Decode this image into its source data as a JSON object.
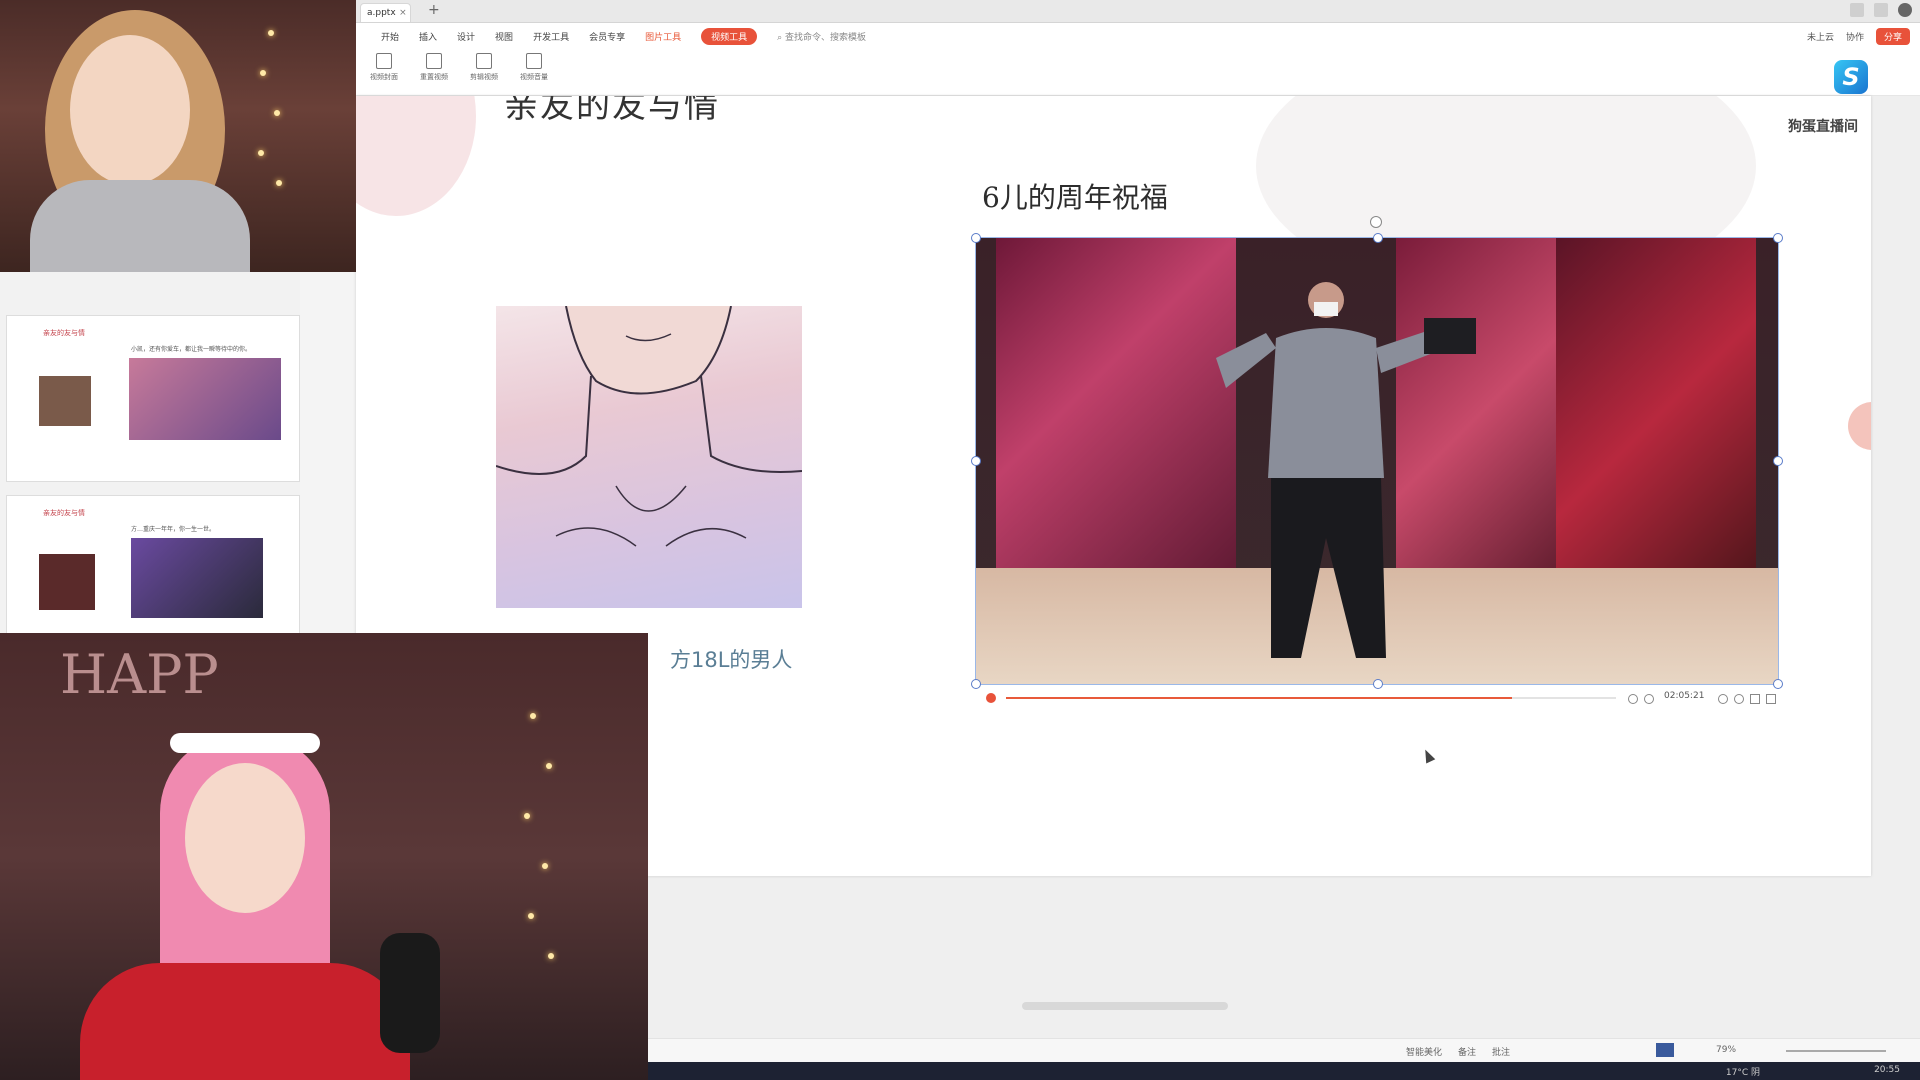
{
  "tabbar": {
    "doc_tab": "a.pptx",
    "new_tab": "+"
  },
  "ribbon": {
    "menu": [
      "开始",
      "插入",
      "设计",
      "视图",
      "开发工具",
      "会员专享",
      "图片工具",
      "视频工具"
    ],
    "search": "查找命令、搜索模板",
    "tools": [
      "视频封面",
      "重置视频",
      "剪辑视频",
      "视频音量"
    ],
    "right": [
      "未上云",
      "协作",
      "分享"
    ]
  },
  "slide": {
    "heading": "亲友的友与情",
    "video_title": "6儿的周年祝福",
    "caption": "方18L的男人",
    "video_time": "02:05:21",
    "video_progress": 0.83
  },
  "thumbnails": [
    {
      "title": "亲友的友与情",
      "caption": "小凯，还有你爱车，都让我一瞬等待中的你。"
    },
    {
      "title": "亲友的友与情",
      "caption": "方…重庆一年年，你一生一世。"
    }
  ],
  "overlay": {
    "logo_letter": "S",
    "watermark": "狗蛋直播间"
  },
  "status": {
    "items": [
      "智能美化",
      "备注",
      "批注"
    ],
    "zoom": "79%"
  },
  "taskbar": {
    "weather": "17°C 阴",
    "clock": "20:55"
  },
  "colors": {
    "accent": "#e8523a",
    "caption": "#5a7e95",
    "slide_bg": "#ffffff"
  }
}
